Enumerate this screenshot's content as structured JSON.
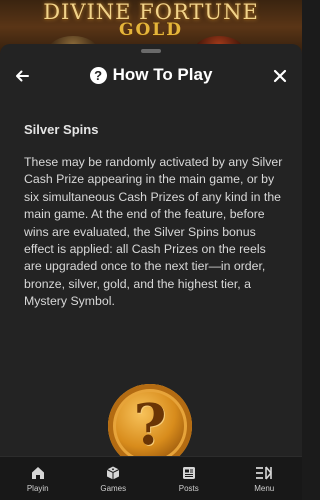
{
  "game": {
    "title": "DIVINE FORTUNE",
    "subtitle": "GOLD"
  },
  "header": {
    "title": "How To Play"
  },
  "content": {
    "section_title": "Silver Spins",
    "body": "These may be randomly activated by any Silver Cash Prize appearing in the main game, or by six simultaneous Cash Prizes of any kind in the main game. At the end of the feature, before wins are evaluated, the Silver Spins bonus effect is applied: all Cash Prizes on the reels are upgraded once to the next tier—in order, bronze, silver, gold, and the highest tier, a Mystery Symbol."
  },
  "tabs": [
    {
      "label": "Playin",
      "icon": "home-icon"
    },
    {
      "label": "Games",
      "icon": "dice-icon"
    },
    {
      "label": "Posts",
      "icon": "news-icon"
    },
    {
      "label": "Menu",
      "icon": "menu-icon"
    }
  ]
}
